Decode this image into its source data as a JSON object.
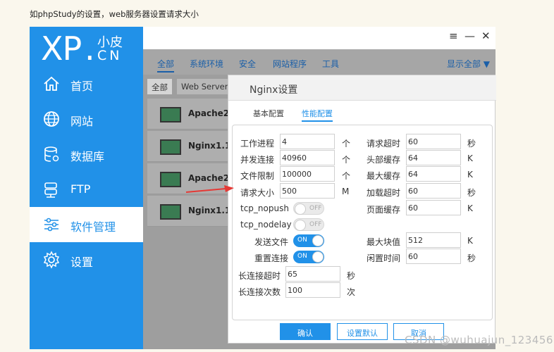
{
  "caption": "如phpStudy的设置，web服务器设置请求大小",
  "logo": {
    "main": "XP",
    "dot": ".",
    "small": "小皮",
    "cn": "CN"
  },
  "window": {
    "menu_icon": "≡",
    "min_icon": "—",
    "close_icon": "✕"
  },
  "sidebar": {
    "items": [
      {
        "label": "首页",
        "icon": "home-icon"
      },
      {
        "label": "网站",
        "icon": "globe-icon"
      },
      {
        "label": "数据库",
        "icon": "database-icon"
      },
      {
        "label": "FTP",
        "icon": "ftp-icon"
      },
      {
        "label": "软件管理",
        "icon": "sliders-icon",
        "active": true
      },
      {
        "label": "设置",
        "icon": "gear-icon"
      }
    ]
  },
  "tabs": [
    "全部",
    "系统环境",
    "安全",
    "网站程序",
    "工具"
  ],
  "show_all": "显示全部 ▼",
  "subtabs": [
    "全部",
    "Web Servers"
  ],
  "software": [
    "Apache2.4",
    "Nginx1.15",
    "Apache2.4",
    "Nginx1.16"
  ],
  "dialog": {
    "title": "Nginx设置",
    "tabs": [
      "基本配置",
      "性能配置"
    ],
    "left_fields": [
      {
        "label": "工作进程",
        "value": "4",
        "unit": "个"
      },
      {
        "label": "并发连接",
        "value": "40960",
        "unit": "个"
      },
      {
        "label": "文件限制",
        "value": "100000",
        "unit": "个"
      },
      {
        "label": "请求大小",
        "value": "500",
        "unit": "M"
      }
    ],
    "right_fields": [
      {
        "label": "请求超时",
        "value": "60",
        "unit": "秒"
      },
      {
        "label": "头部缓存",
        "value": "64",
        "unit": "K"
      },
      {
        "label": "最大缓存",
        "value": "64",
        "unit": "K"
      },
      {
        "label": "加载超时",
        "value": "60",
        "unit": "秒"
      },
      {
        "label": "页面缓存",
        "value": "60",
        "unit": "K"
      }
    ],
    "toggles": [
      {
        "label": "tcp_nopush",
        "state": "OFF"
      },
      {
        "label": "tcp_nodelay",
        "state": "OFF"
      },
      {
        "label": "发送文件",
        "state": "ON"
      },
      {
        "label": "重置连接",
        "state": "ON"
      }
    ],
    "extra_right": [
      {
        "label": "最大块值",
        "value": "512",
        "unit": "K"
      },
      {
        "label": "闲置时间",
        "value": "60",
        "unit": "秒"
      }
    ],
    "keepalive": [
      {
        "label": "长连接超时",
        "value": "65",
        "unit": "秒"
      },
      {
        "label": "长连接次数",
        "value": "100",
        "unit": "次"
      }
    ],
    "buttons": {
      "confirm": "确认",
      "default": "设置默认",
      "cancel": "取消"
    }
  },
  "watermark": "CSDN @wuhuajun_123456",
  "colors": {
    "accent": "#2191e8",
    "arrow": "#e53935"
  }
}
